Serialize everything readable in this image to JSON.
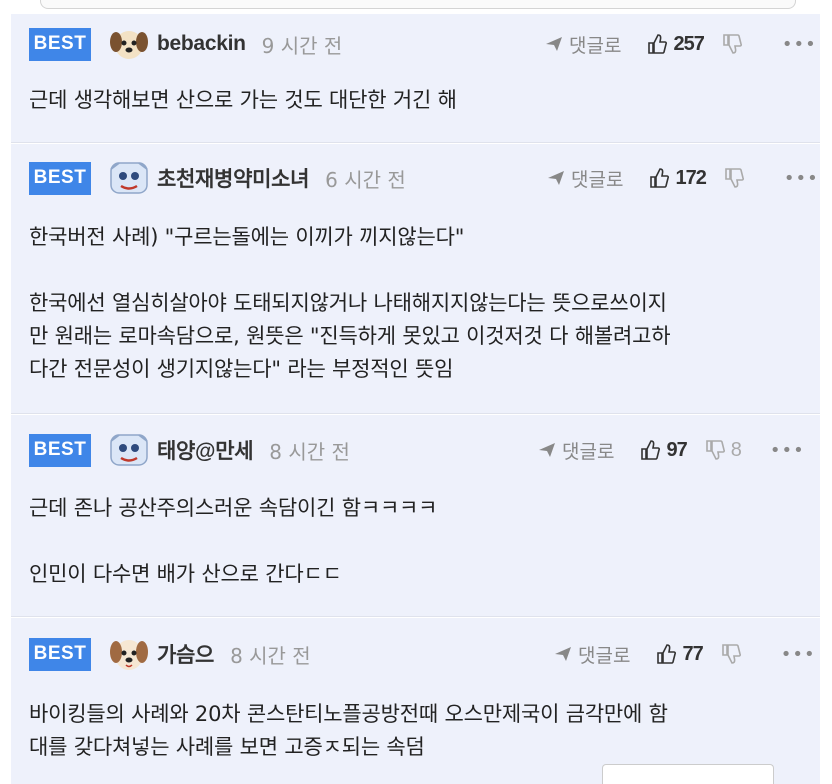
{
  "comments": [
    {
      "badge": "BEST",
      "nickname": "bebackin",
      "time": "9 시간 전",
      "reply_label": "댓글로",
      "likes": "257",
      "dislikes": "",
      "body": "근데 생각해보면 산으로 가는 것도 대단한 거긴 해"
    },
    {
      "badge": "BEST",
      "nickname": "초천재병약미소녀",
      "time": "6 시간 전",
      "reply_label": "댓글로",
      "likes": "172",
      "dislikes": "",
      "body": "한국버전 사례) \"구르는돌에는 이끼가 끼지않는다\"\n\n한국에선 열심히살아야 도태되지않거나 나태해지지않는다는 뜻으로쓰이지\n만 원래는 로마속담으로, 원뜻은 \"진득하게 못있고 이것저것 다 해볼려고하\n다간 전문성이 생기지않는다\" 라는 부정적인 뜻임"
    },
    {
      "badge": "BEST",
      "nickname": "태양@만세",
      "time": "8 시간 전",
      "reply_label": "댓글로",
      "likes": "97",
      "dislikes": "8",
      "body": "근데 존나 공산주의스러운 속담이긴 함ㅋㅋㅋㅋ\n\n인민이 다수면 배가 산으로 간다ㄷㄷ"
    },
    {
      "badge": "BEST",
      "nickname": "가슴으",
      "time": "8 시간 전",
      "reply_label": "댓글로",
      "likes": "77",
      "dislikes": "",
      "body": "바이킹들의 사례와 20차 콘스탄티노플공방전때 오스만제국이 금각만에 함\n대를 갖다쳐넣는 사례를 보면 고증ㅈ되는 속덤"
    }
  ],
  "icons": {
    "reply": "reply-arrow-icon",
    "like": "thumbs-up-icon",
    "dislike": "thumbs-down-icon",
    "more": "more-dots-icon",
    "avatar_dog": "dog-avatar-icon",
    "avatar_sticker": "sticker-avatar-icon"
  },
  "colors": {
    "badge_bg": "#3f86e8",
    "card_bg": "#eef1fb",
    "muted": "#999999"
  }
}
